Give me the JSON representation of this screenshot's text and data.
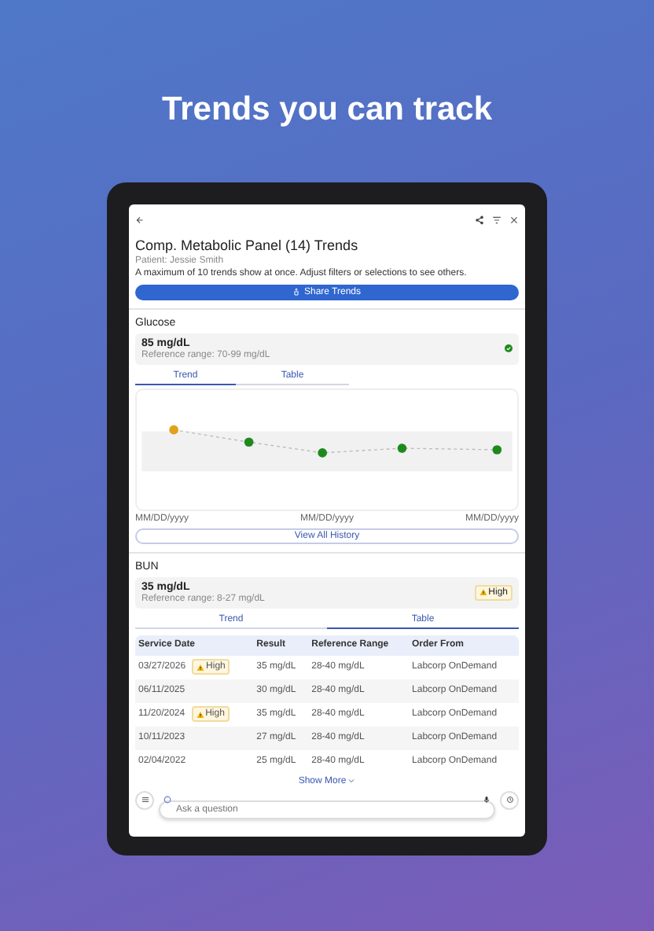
{
  "headline": "Trends you can track",
  "header": {
    "title": "Comp. Metabolic Panel (14) Trends",
    "patient": "Patient: Jessie Smith",
    "note": "A maximum of 10 trends show at once. Adjust filters or selections to see others.",
    "share_button": "Share Trends"
  },
  "glucose": {
    "name": "Glucose",
    "value": "85 mg/dL",
    "reference": "Reference range: 70-99 mg/dL",
    "tabs": [
      {
        "label": "Trend",
        "selected": true
      },
      {
        "label": "Table",
        "selected": false
      }
    ],
    "chart_points": [
      {
        "color": "#e0a21a"
      },
      {
        "color": "#1e8a1e"
      },
      {
        "color": "#1e8a1e"
      },
      {
        "color": "#1e8a1e"
      },
      {
        "color": "#1e8a1e"
      }
    ],
    "x_labels": [
      "MM/DD/yyyy",
      "MM/DD/yyyy",
      "MM/DD/yyyy"
    ],
    "history_button": "View All History"
  },
  "bun": {
    "name": "BUN",
    "value": "35 mg/dL",
    "reference": "Reference range: 8-27 mg/dL",
    "badge": "High",
    "tabs": [
      {
        "label": "Trend",
        "selected": false
      },
      {
        "label": "Table",
        "selected": true
      }
    ],
    "table": {
      "columns": [
        "Service Date",
        "Result",
        "Reference Range",
        "Order From"
      ],
      "rows": [
        {
          "date": "03/27/2026",
          "flag": "High",
          "result": "35 mg/dL",
          "range": "28-40 mg/dL",
          "order": "Labcorp OnDemand"
        },
        {
          "date": "06/11/2025",
          "result": "30 mg/dL",
          "range": "28-40 mg/dL",
          "order": "Labcorp OnDemand"
        },
        {
          "date": "11/20/2024",
          "flag": "High",
          "result": "35 mg/dL",
          "range": "28-40 mg/dL",
          "order": "Labcorp OnDemand"
        },
        {
          "date": "10/11/2023",
          "result": "27 mg/dL",
          "range": "28-40 mg/dL",
          "order": "Labcorp OnDemand"
        },
        {
          "date": "02/04/2022",
          "result": "25 mg/dL",
          "range": "28-40 mg/dL",
          "order": "Labcorp OnDemand"
        }
      ]
    },
    "show_more": "Show More"
  },
  "bottom_bar": {
    "placeholder": "Ask a question"
  }
}
